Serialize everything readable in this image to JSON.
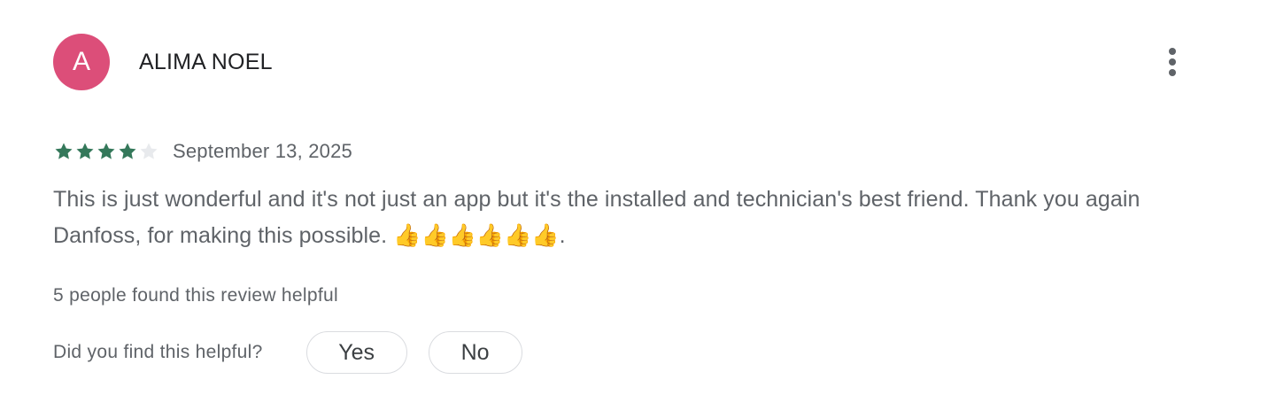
{
  "author": {
    "initial": "A",
    "name": "ALIMA NOEL",
    "avatar_color": "#dc4e79"
  },
  "menu": {
    "icon": "more-vert-icon"
  },
  "rating": {
    "value": 4,
    "max": 5,
    "filled_color": "#34785a",
    "empty_color": "#e8eaed"
  },
  "date": "September 13, 2025",
  "review_text": "This is just wonderful and it's not just an app but it's the installed and technician's best friend. Thank you again Danfoss, for making this possible. 👍👍👍👍👍👍.",
  "helpful_count_text": "5 people found this review helpful",
  "helpful_prompt": {
    "question": "Did you find this helpful?",
    "yes_label": "Yes",
    "no_label": "No"
  }
}
